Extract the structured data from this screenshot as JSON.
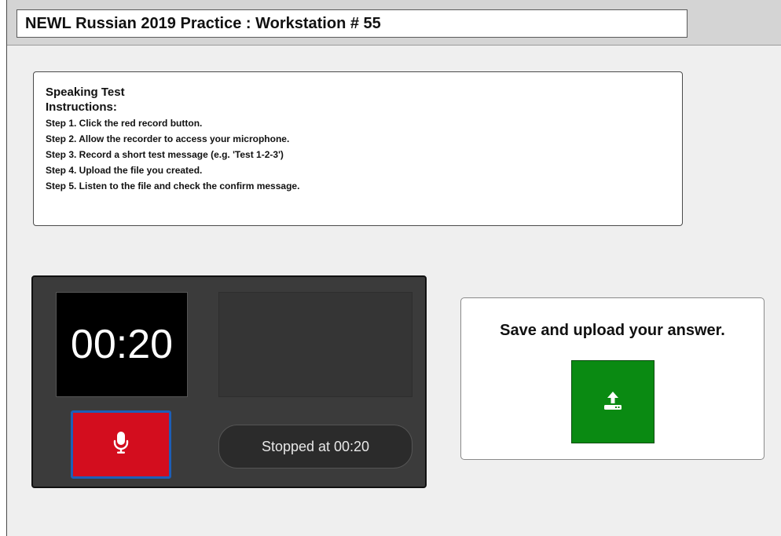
{
  "window": {
    "title": "NEWL Russian 2019 Practice : Workstation # 55"
  },
  "instructions": {
    "heading": "Speaking Test",
    "subheading": "Instructions:",
    "steps": [
      "Step 1. Click the red record button.",
      "Step 2. Allow the recorder to access your microphone.",
      "Step 3. Record a short test message (e.g. 'Test 1-2-3')",
      "Step 4. Upload the file you created.",
      "Step 5. Listen to the file and check the confirm message."
    ]
  },
  "recorder": {
    "timer": "00:20",
    "status": "Stopped at 00:20",
    "record_icon": "microphone-icon",
    "colors": {
      "panel": "#3b3b3b",
      "record_button": "#d30d1e",
      "record_focus_border": "#1d5fb8"
    }
  },
  "upload": {
    "title": "Save and upload your answer.",
    "icon": "upload-icon",
    "colors": {
      "button": "#0a8a12"
    }
  }
}
